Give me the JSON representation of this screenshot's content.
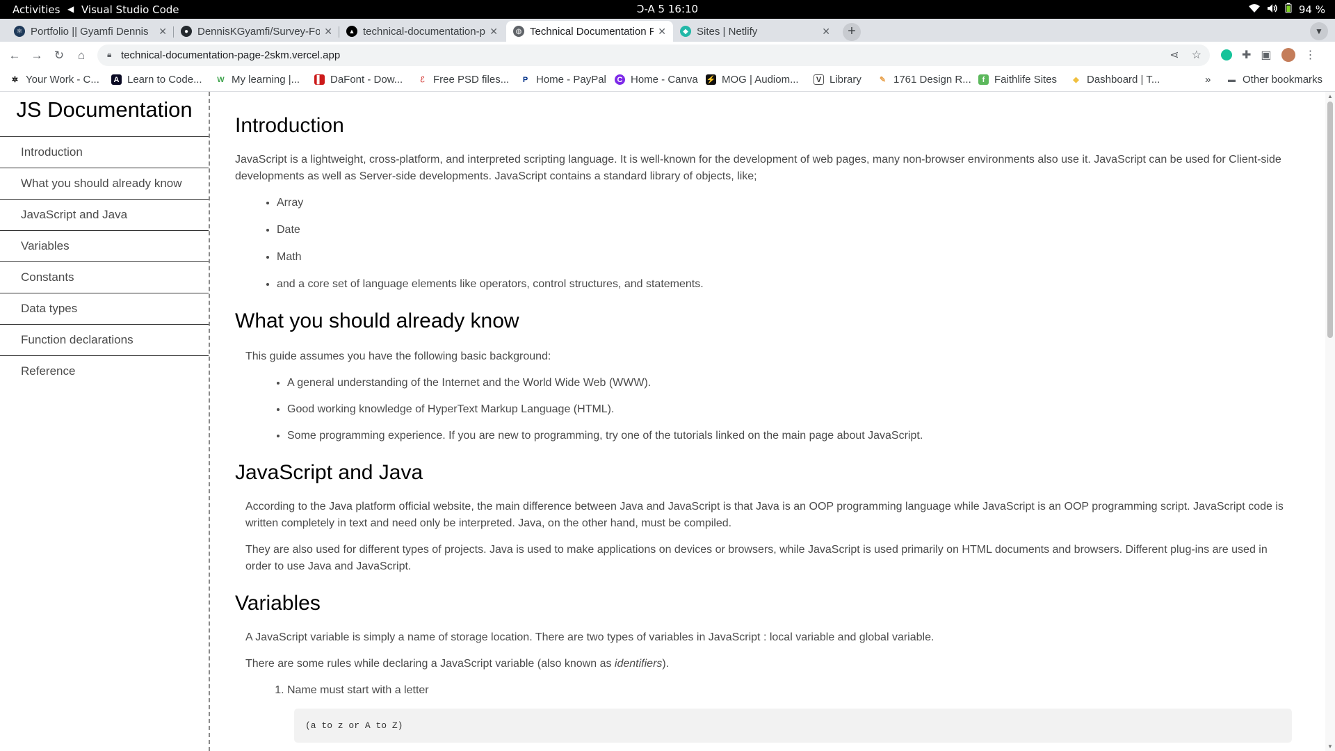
{
  "os": {
    "activities": "Activities",
    "app_name": "Visual Studio Code",
    "clock": "Ɔ-A 5  16:10",
    "battery": "94 %"
  },
  "browser": {
    "tabs": [
      {
        "title": "Portfolio || Gyamfi Dennis",
        "active": false
      },
      {
        "title": "DennisKGyamfi/Survey-Form",
        "active": false
      },
      {
        "title": "technical-documentation-page",
        "active": false
      },
      {
        "title": "Technical Documentation Page",
        "active": true
      },
      {
        "title": "Sites | Netlify",
        "active": false
      }
    ],
    "url": "technical-documentation-page-2skm.vercel.app",
    "bookmarks": [
      "Your Work - C...",
      "Learn to Code...",
      "My learning |...",
      "DaFont - Dow...",
      "Free PSD files...",
      "Home - PayPal",
      "Home - Canva",
      "MOG | Audiom...",
      "Library",
      "1761 Design R...",
      "Faithlife Sites",
      "Dashboard | T..."
    ],
    "more_bookmarks": "»",
    "other_bookmarks": "Other bookmarks"
  },
  "nav": {
    "title": "JS Documentation",
    "links": [
      "Introduction",
      "What you should already know",
      "JavaScript and Java",
      "Variables",
      "Constants",
      "Data types",
      "Function declarations",
      "Reference"
    ]
  },
  "sections": {
    "intro": {
      "heading": "Introduction",
      "p1": "JavaScript is a lightweight, cross-platform, and interpreted scripting language. It is well-known for the development of web pages, many non-browser environments also use it. JavaScript can be used for Client-side developments as well as Server-side developments. JavaScript contains a standard library of objects, like;",
      "items": [
        "Array",
        "Date",
        "Math",
        "and a core set of language elements like operators, control structures, and statements."
      ]
    },
    "know": {
      "heading": "What you should already know",
      "p1": "This guide assumes you have the following basic background:",
      "items": [
        "A general understanding of the Internet and the World Wide Web (WWW).",
        "Good working knowledge of HyperText Markup Language (HTML).",
        "Some programming experience. If you are new to programming, try one of the tutorials linked on the main page about JavaScript."
      ]
    },
    "java": {
      "heading": "JavaScript and Java",
      "p1": "According to the Java platform official website, the main difference between Java and JavaScript is that Java is an OOP programming language while JavaScript is an OOP programming script. JavaScript code is written completely in text and need only be interpreted. Java, on the other hand, must be compiled.",
      "p2": "They are also used for different types of projects. Java is used to make applications on devices or browsers, while JavaScript is used primarily on HTML documents and browsers. Different plug-ins are used in order to use Java and JavaScript."
    },
    "variables": {
      "heading": "Variables",
      "p1": "A JavaScript variable is simply a name of storage location. There are two types of variables in JavaScript : local variable and global variable.",
      "p2_before": "There are some rules while declaring a JavaScript variable (also known as ",
      "p2_em": "identifiers",
      "p2_after": ").",
      "rule1": "Name must start with a letter",
      "code1": "(a to z or A to Z)"
    }
  }
}
